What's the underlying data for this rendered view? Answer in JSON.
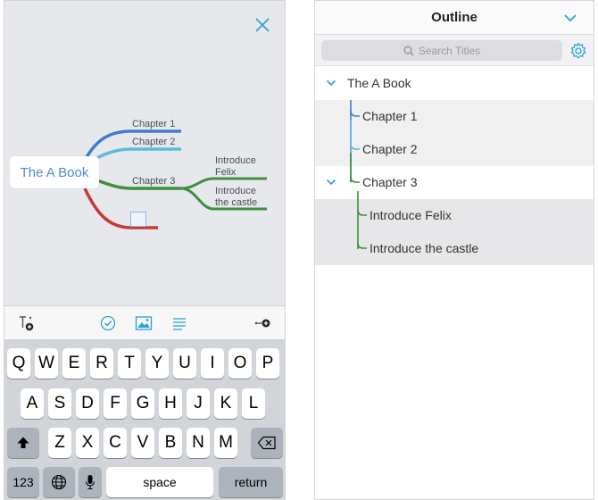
{
  "left_panel": {
    "mindmap": {
      "root": "The A Book",
      "branches": [
        {
          "label": "Chapter 1",
          "color": "#3f7dd1"
        },
        {
          "label": "Chapter 2",
          "color": "#5bbdd4"
        },
        {
          "label": "Chapter 3",
          "color": "#3f8f3f"
        },
        {
          "label": "",
          "color": "#c93a37"
        }
      ],
      "subtopics": [
        {
          "line1": "Introduce",
          "line2": "Felix"
        },
        {
          "line1": "Introduce",
          "line2": "the castle"
        }
      ]
    },
    "toolbar": {
      "icons": [
        "add-subtopic-icon",
        "checkmark-icon",
        "image-icon",
        "notes-icon",
        "add-relation-icon"
      ]
    },
    "keyboard": {
      "row1": [
        "Q",
        "W",
        "E",
        "R",
        "T",
        "Y",
        "U",
        "I",
        "O",
        "P"
      ],
      "row2": [
        "A",
        "S",
        "D",
        "F",
        "G",
        "H",
        "J",
        "K",
        "L"
      ],
      "row3": [
        "Z",
        "X",
        "C",
        "V",
        "B",
        "N",
        "M"
      ],
      "numbers_key": "123",
      "space_key": "space",
      "return_key": "return"
    }
  },
  "right_panel": {
    "title": "Outline",
    "search": {
      "placeholder": "Search Titles"
    },
    "rows": [
      {
        "label": "The A Book",
        "expanded": true
      },
      {
        "label": "Chapter 1"
      },
      {
        "label": "Chapter 2"
      },
      {
        "label": "Chapter 3",
        "expanded": true
      },
      {
        "label": "Introduce Felix"
      },
      {
        "label": "Introduce the castle"
      }
    ]
  },
  "colors": {
    "accent": "#2a9fd6",
    "chapter1": "#3f7dd1",
    "chapter2": "#5bbdd4",
    "chapter3": "#3f8f3f",
    "chapter4": "#c93a37"
  }
}
